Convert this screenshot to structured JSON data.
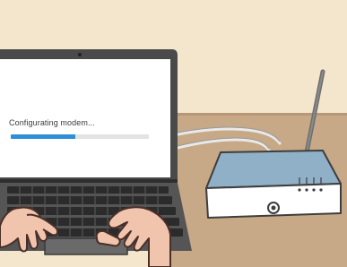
{
  "screen": {
    "status_text": "Configurating modem...",
    "progress_fraction": 0.47,
    "progress_color": "#2f8ed8"
  },
  "colors": {
    "wall": "#f3e6cc",
    "desk": "#c7a987",
    "router_top": "#8fb0c6",
    "router_front": "#ffffff",
    "laptop_body": "#4a4a4a",
    "skin": "#f1c4ae"
  },
  "icons": [
    "laptop",
    "router",
    "antenna",
    "ethernet-cable",
    "router-led",
    "hand"
  ]
}
